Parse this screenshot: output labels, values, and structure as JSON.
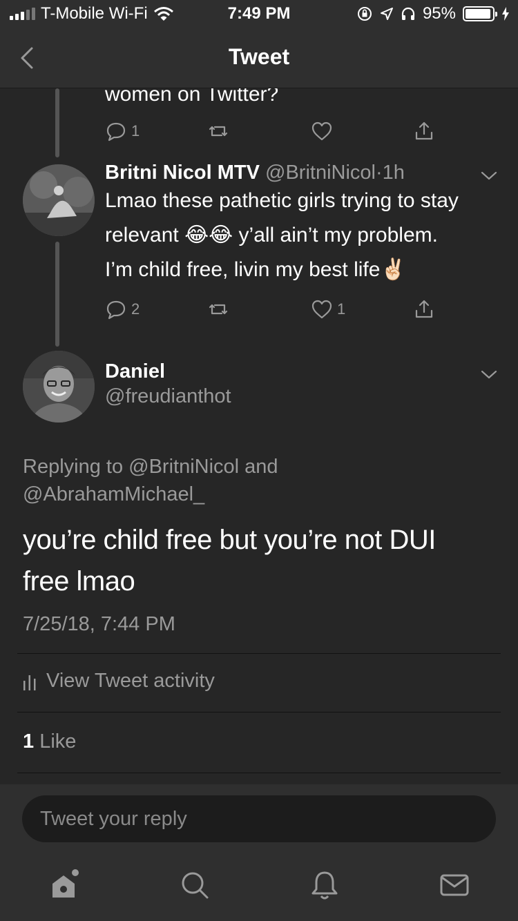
{
  "status_bar": {
    "carrier": "T-Mobile Wi-Fi",
    "time": "7:49 PM",
    "battery": "95%",
    "battery_level": 0.95
  },
  "nav": {
    "title": "Tweet",
    "back_icon": "chevron-left-icon"
  },
  "prev_tweet": {
    "text_fragment": "women on Twitter?",
    "reply_count": "1",
    "like_count": ""
  },
  "parent_tweet": {
    "name": "Britni Nicol MTV",
    "handle": "@BritniNicol",
    "separator": "·",
    "time_ago": "1h",
    "text_line1": "Lmao these pathetic girls trying to stay",
    "text_line2_a": "relevant",
    "text_line2_emoji": "😂😂",
    "text_line2_b": "y’all ain’t my problem.",
    "text_line3": "I’m child free, livin my best life",
    "text_line3_emoji": "✌🏻",
    "reply_count": "2",
    "like_count": "1"
  },
  "main_tweet": {
    "name": "Daniel",
    "handle": "@freudianthot",
    "replying_line1": "Replying to @BritniNicol and",
    "replying_line2": "@AbrahamMichael_",
    "text_line1": "you’re child free but you’re not DUI",
    "text_line2": "free lmao",
    "timestamp": "7/25/18, 7:44 PM",
    "activity_label": "View Tweet activity",
    "likes_count": "1",
    "likes_label": "Like"
  },
  "reply_bar": {
    "placeholder": "Tweet your reply"
  },
  "tab_bar": {
    "items": [
      "home-icon",
      "search-icon",
      "notifications-icon",
      "messages-icon"
    ]
  },
  "colors": {
    "background": "#262626",
    "bar": "#2f2f2f",
    "secondary_text": "#9a9a9a"
  }
}
